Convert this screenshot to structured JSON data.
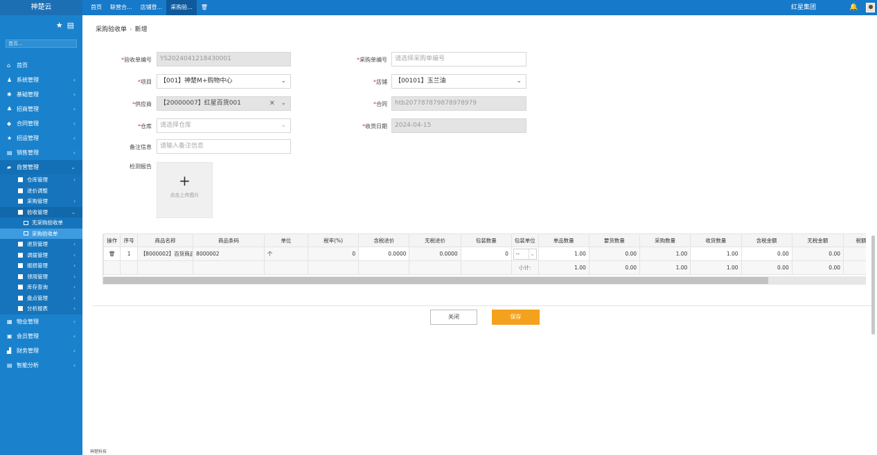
{
  "brand": "神楚云",
  "tabs": [
    {
      "label": "首页"
    },
    {
      "label": "联营合..."
    },
    {
      "label": "店铺登..."
    },
    {
      "label": "采购验..."
    }
  ],
  "company": "红星集团",
  "search_placeholder": "首页...",
  "menu": [
    {
      "icon": "home-icon",
      "glyph": "⌂",
      "label": "首页"
    },
    {
      "icon": "user-icon",
      "glyph": "♟",
      "label": "系统管理"
    },
    {
      "icon": "gear-icon",
      "glyph": "✱",
      "label": "基础管理"
    },
    {
      "icon": "people-icon",
      "glyph": "♣",
      "label": "招商管理"
    },
    {
      "icon": "contract-icon",
      "glyph": "◆",
      "label": "合同管理"
    },
    {
      "icon": "star-icon",
      "glyph": "★",
      "label": "招运管理"
    },
    {
      "icon": "chart-icon",
      "glyph": "▤",
      "label": "销售管理"
    },
    {
      "icon": "folder-icon",
      "glyph": "▰",
      "label": "自营管理"
    }
  ],
  "submenu": [
    {
      "label": "仓库管理"
    },
    {
      "label": "进价调整"
    },
    {
      "label": "采购管理"
    },
    {
      "label": "验收管理"
    }
  ],
  "subsubmenu": [
    {
      "label": "无采购验收单"
    },
    {
      "label": "采购验收单"
    }
  ],
  "submenu2": [
    {
      "label": "退货管理"
    },
    {
      "label": "调拨管理"
    },
    {
      "label": "报损管理"
    },
    {
      "label": "领用管理"
    },
    {
      "label": "库存查询"
    },
    {
      "label": "盘点管理"
    },
    {
      "label": "分析报表"
    }
  ],
  "menu2": [
    {
      "icon": "building-icon",
      "glyph": "▦",
      "label": "物业管理"
    },
    {
      "icon": "member-icon",
      "glyph": "▣",
      "label": "会员管理"
    },
    {
      "icon": "finance-icon",
      "glyph": "▟",
      "label": "财务管理"
    },
    {
      "icon": "analysis-icon",
      "glyph": "▤",
      "label": "智能分析"
    }
  ],
  "breadcrumb": {
    "parent": "采购验收单",
    "current": "新增"
  },
  "form": {
    "receipt_no_label": "验收单编号",
    "receipt_no_value": "YS2024041218430001",
    "po_no_label": "采购单编号",
    "po_no_placeholder": "请选择采购单编号",
    "project_label": "项目",
    "project_value": "【001】神楚M+购物中心",
    "store_label": "店铺",
    "store_value": "【00101】玉兰油",
    "supplier_label": "供应商",
    "supplier_value": "【20000007】红星百货001",
    "contract_label": "合同",
    "contract_value": "htb207787879878978979",
    "warehouse_label": "仓库",
    "warehouse_placeholder": "请选择仓库",
    "date_label": "收货日期",
    "date_value": "2024-04-15",
    "remark_label": "备注信息",
    "remark_placeholder": "请输入备注信息",
    "report_label": "检测报告",
    "upload_text": "点击上传图片"
  },
  "table": {
    "headers": [
      "操作",
      "序号",
      "商品名称",
      "商品条码",
      "单位",
      "税率(%)",
      "含税进价",
      "无税进价",
      "包装数量",
      "包装单位",
      "单品数量",
      "要货数量",
      "采购数量",
      "收货数量",
      "含税金额",
      "无税金额",
      "税额"
    ],
    "row": {
      "seq": "1",
      "name": "【8000002】百货商品2",
      "barcode": "8000002",
      "unit": "个",
      "tax_rate": "0",
      "price_tax": "0.0000",
      "price_notax": "0.0000",
      "pack_qty": "0",
      "pack_unit": "--",
      "item_qty": "1.00",
      "req_qty": "0.00",
      "po_qty": "1.00",
      "recv_qty": "1.00",
      "amt_tax": "0.00",
      "amt_notax": "0.00",
      "tax": "0"
    },
    "subtotal": {
      "label": "小计:",
      "item_qty": "1.00",
      "req_qty": "0.00",
      "po_qty": "1.00",
      "recv_qty": "1.00",
      "amt_tax": "0.00",
      "amt_notax": "0.00",
      "tax": "0"
    }
  },
  "buttons": {
    "close": "关闭",
    "save": "保存"
  },
  "footer": "神楚科技",
  "colors": {
    "topbar": "#1779c9",
    "sidebar": "#1a82cc",
    "save": "#f4a21d"
  }
}
